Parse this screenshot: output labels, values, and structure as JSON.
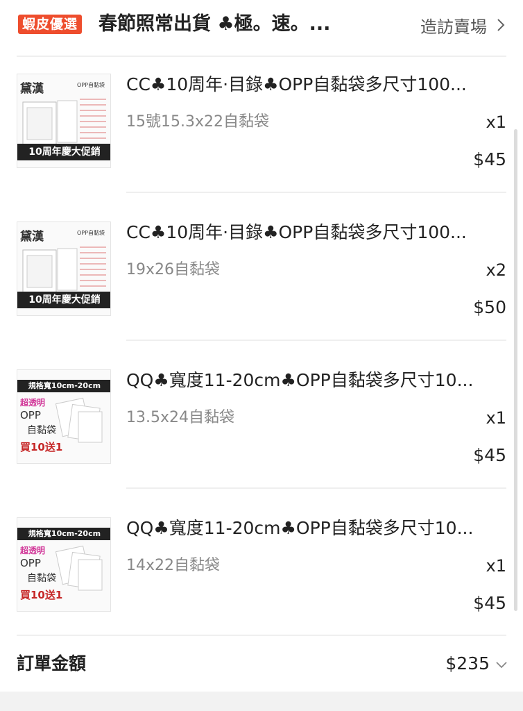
{
  "header": {
    "badge": "蝦皮優選",
    "shop_name": "春節照常出貨 ♣極。速。...",
    "visit_label": "造訪賣場"
  },
  "items": [
    {
      "title": "CC♣10周年·目錄♣OPP自黏袋多尺寸100...",
      "variant": "15號15.3x22自黏袋",
      "qty": "x1",
      "price": "$45",
      "thumb_type": "catalog",
      "thumb_banner": "10周年慶大促銷"
    },
    {
      "title": "CC♣10周年·目錄♣OPP自黏袋多尺寸100...",
      "variant": "19x26自黏袋",
      "qty": "x2",
      "price": "$50",
      "thumb_type": "catalog",
      "thumb_banner": "10周年慶大促銷"
    },
    {
      "title": "QQ♣寬度11-20cm♣OPP自黏袋多尺寸10...",
      "variant": "13.5x24自黏袋",
      "qty": "x1",
      "price": "$45",
      "thumb_type": "width",
      "thumb_top": "規格寬10cm-20cm",
      "thumb_line1": "超透明",
      "thumb_line2": "OPP",
      "thumb_line3": "自黏袋",
      "thumb_line4": "買10送1"
    },
    {
      "title": "QQ♣寬度11-20cm♣OPP自黏袋多尺寸10...",
      "variant": "14x22自黏袋",
      "qty": "x1",
      "price": "$45",
      "thumb_type": "width",
      "thumb_top": "規格寬10cm-20cm",
      "thumb_line1": "超透明",
      "thumb_line2": "OPP",
      "thumb_line3": "自黏袋",
      "thumb_line4": "買10送1"
    }
  ],
  "total": {
    "label": "訂單金額",
    "value": "$235"
  },
  "colors": {
    "badge": "#ee4d2d",
    "text": "#222222",
    "muted": "#888888"
  }
}
